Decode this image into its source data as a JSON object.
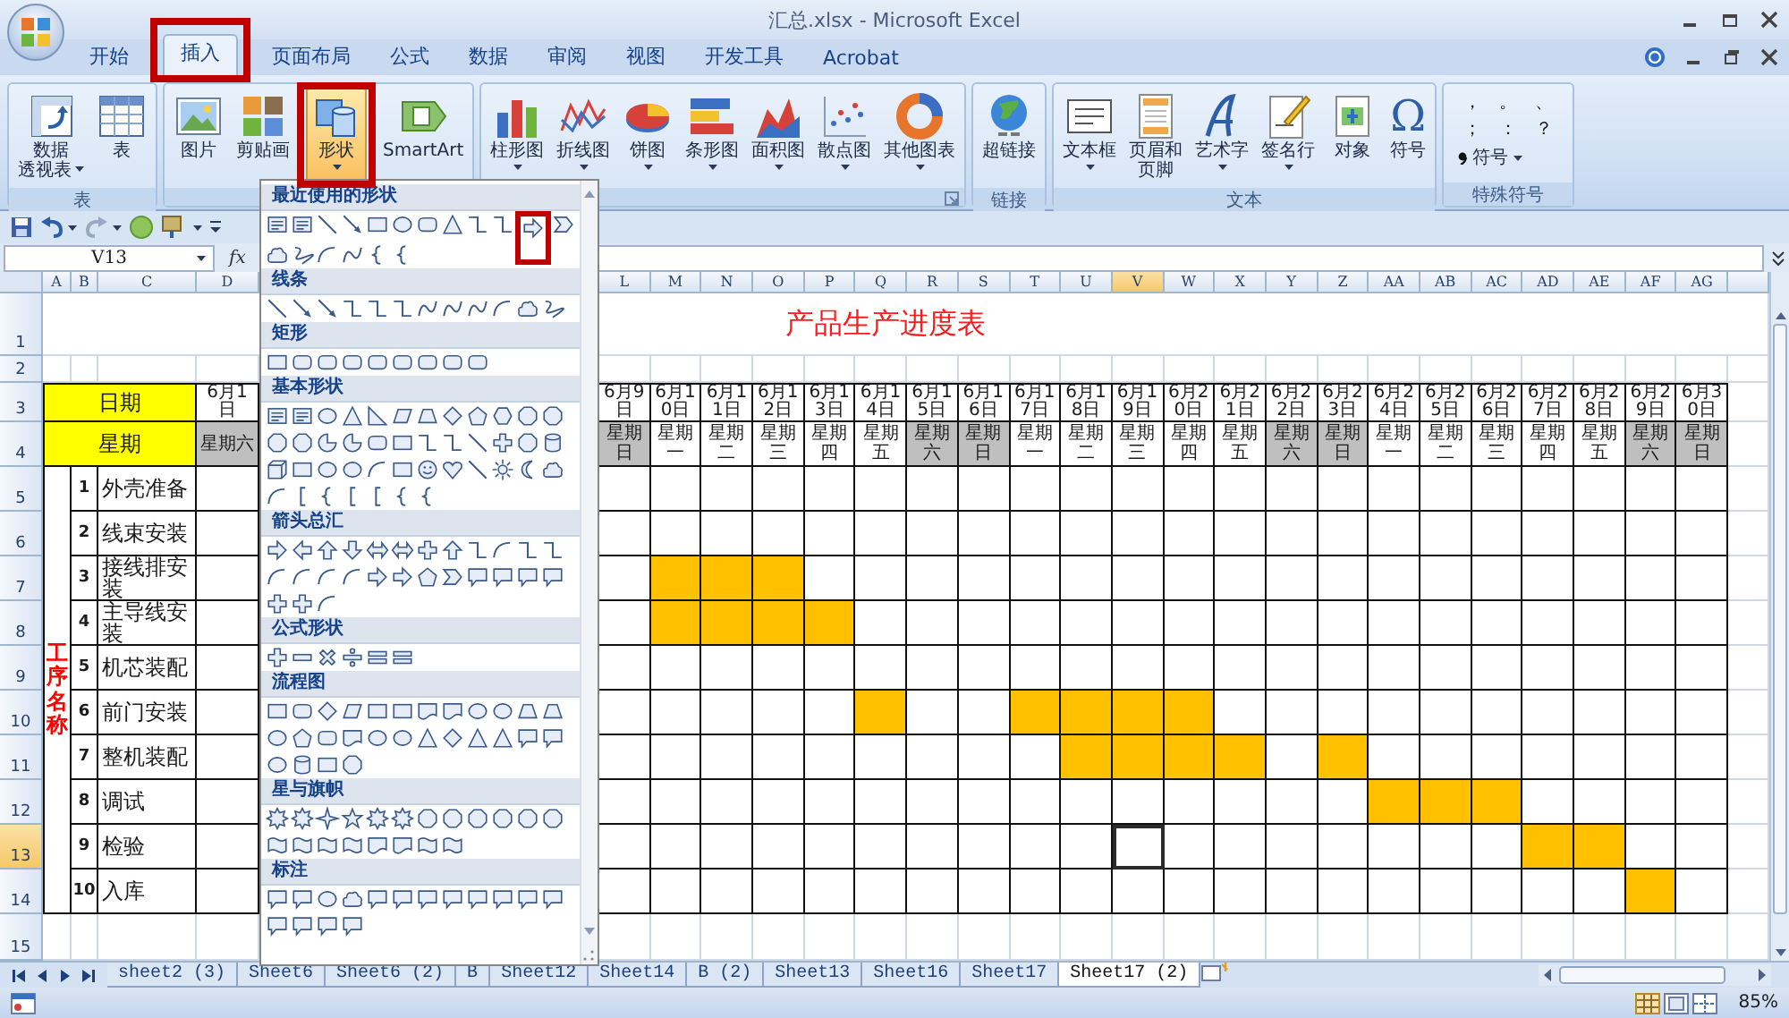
{
  "window": {
    "title": "汇总.xlsx - Microsoft Excel"
  },
  "ribbon_tabs": [
    {
      "label": "开始",
      "selected": false
    },
    {
      "label": "插入",
      "selected": true
    },
    {
      "label": "页面布局",
      "selected": false
    },
    {
      "label": "公式",
      "selected": false
    },
    {
      "label": "数据",
      "selected": false
    },
    {
      "label": "审阅",
      "selected": false
    },
    {
      "label": "视图",
      "selected": false
    },
    {
      "label": "开发工具",
      "selected": false
    },
    {
      "label": "Acrobat",
      "selected": false
    }
  ],
  "ribbon": {
    "groups": [
      {
        "kind": "buttons",
        "label": "表",
        "launcher": false,
        "buttons": [
          {
            "lines": [
              "数据",
              "透视表"
            ],
            "dropdown": true,
            "selected": false
          },
          {
            "label": "表",
            "dropdown": false,
            "selected": false
          }
        ]
      },
      {
        "kind": "buttons",
        "launcher": false,
        "buttons": [
          {
            "label": "图片",
            "dropdown": false,
            "selected": false
          },
          {
            "label": "剪贴画",
            "dropdown": false,
            "selected": false
          },
          {
            "label": "形状",
            "dropdown": true,
            "selected": true
          },
          {
            "label": "SmartArt",
            "dropdown": false,
            "selected": false
          }
        ]
      },
      {
        "kind": "buttons",
        "launcher": true,
        "buttons": [
          {
            "label": "柱形图",
            "dropdown": true,
            "selected": false
          },
          {
            "label": "折线图",
            "dropdown": true,
            "selected": false
          },
          {
            "label": "饼图",
            "dropdown": true,
            "selected": false
          },
          {
            "label": "条形图",
            "dropdown": true,
            "selected": false
          },
          {
            "label": "面积图",
            "dropdown": true,
            "selected": false
          },
          {
            "label": "散点图",
            "dropdown": true,
            "selected": false
          },
          {
            "label": "其他图表",
            "dropdown": true,
            "selected": false
          }
        ]
      },
      {
        "kind": "buttons",
        "label": "链接",
        "launcher": false,
        "buttons": [
          {
            "label": "超链接",
            "dropdown": false,
            "selected": false
          }
        ]
      },
      {
        "kind": "buttons",
        "label": "文本",
        "launcher": false,
        "buttons": [
          {
            "label": "文本框",
            "dropdown": true,
            "selected": false
          },
          {
            "lines": [
              "页眉和",
              "页脚"
            ],
            "dropdown": false,
            "selected": false
          },
          {
            "label": "艺术字",
            "dropdown": true,
            "selected": false
          },
          {
            "label": "签名行",
            "dropdown": true,
            "selected": false
          },
          {
            "label": "对象",
            "dropdown": false,
            "selected": false
          },
          {
            "label": "符号",
            "glyph": "Ω",
            "dropdown": false,
            "selected": false
          }
        ]
      },
      {
        "kind": "symbols",
        "label": "特殊符号",
        "launcher": false,
        "symbols": [
          "，",
          "。",
          "、",
          "；",
          "：",
          "？"
        ],
        "menu": {
          "label": "符号",
          "dropdown": true
        }
      }
    ]
  },
  "formula_bar": {
    "name_box": "V13",
    "function_label": "fx"
  },
  "shapes_menu": {
    "sections": [
      {
        "title": "最近使用的形状"
      },
      {
        "title": "线条"
      },
      {
        "title": "矩形"
      },
      {
        "title": "基本形状"
      },
      {
        "title": "箭头总汇"
      },
      {
        "title": "公式形状"
      },
      {
        "title": "流程图"
      },
      {
        "title": "星与旗帜"
      },
      {
        "title": "标注"
      }
    ]
  },
  "sheet": {
    "columns": [
      {
        "label": "A",
        "selected": false
      },
      {
        "label": "B",
        "selected": false
      },
      {
        "label": "C",
        "selected": false
      },
      {
        "label": "D",
        "selected": false
      },
      {
        "label": "L",
        "selected": false
      },
      {
        "label": "M",
        "selected": false
      },
      {
        "label": "N",
        "selected": false
      },
      {
        "label": "O",
        "selected": false
      },
      {
        "label": "P",
        "selected": false
      },
      {
        "label": "Q",
        "selected": false
      },
      {
        "label": "R",
        "selected": false
      },
      {
        "label": "S",
        "selected": false
      },
      {
        "label": "T",
        "selected": false
      },
      {
        "label": "U",
        "selected": false
      },
      {
        "label": "V",
        "selected": true
      },
      {
        "label": "W",
        "selected": false
      },
      {
        "label": "X",
        "selected": false
      },
      {
        "label": "Y",
        "selected": false
      },
      {
        "label": "Z",
        "selected": false
      },
      {
        "label": "AA",
        "selected": false
      },
      {
        "label": "AB",
        "selected": false
      },
      {
        "label": "AC",
        "selected": false
      },
      {
        "label": "AD",
        "selected": false
      },
      {
        "label": "AE",
        "selected": false
      },
      {
        "label": "AF",
        "selected": false
      },
      {
        "label": "AG",
        "selected": false
      }
    ],
    "rows": [
      {
        "label": "1",
        "selected": false
      },
      {
        "label": "2",
        "selected": false
      },
      {
        "label": "3",
        "selected": false
      },
      {
        "label": "4",
        "selected": false
      },
      {
        "label": "5",
        "selected": false
      },
      {
        "label": "6",
        "selected": false
      },
      {
        "label": "7",
        "selected": false
      },
      {
        "label": "8",
        "selected": false
      },
      {
        "label": "9",
        "selected": false
      },
      {
        "label": "10",
        "selected": false
      },
      {
        "label": "11",
        "selected": false
      },
      {
        "label": "12",
        "selected": false
      },
      {
        "label": "13",
        "selected": true
      },
      {
        "label": "14",
        "selected": false
      },
      {
        "label": "15",
        "selected": false
      }
    ],
    "title": "产品生产进度表",
    "date_label": "日期",
    "weekday_label": "星期",
    "process_label": "工序名称",
    "days": [
      {
        "date": "6月1日",
        "weekday": "星期六",
        "weekend": true
      },
      {
        "date": "6月9日",
        "weekday": "星期日",
        "weekend": true
      },
      {
        "date": "6月10日",
        "weekday": "星期一",
        "weekend": false
      },
      {
        "date": "6月11日",
        "weekday": "星期二",
        "weekend": false
      },
      {
        "date": "6月12日",
        "weekday": "星期三",
        "weekend": false
      },
      {
        "date": "6月13日",
        "weekday": "星期四",
        "weekend": false
      },
      {
        "date": "6月14日",
        "weekday": "星期五",
        "weekend": false
      },
      {
        "date": "6月15日",
        "weekday": "星期六",
        "weekend": true
      },
      {
        "date": "6月16日",
        "weekday": "星期日",
        "weekend": true
      },
      {
        "date": "6月17日",
        "weekday": "星期一",
        "weekend": false
      },
      {
        "date": "6月18日",
        "weekday": "星期二",
        "weekend": false
      },
      {
        "date": "6月19日",
        "weekday": "星期三",
        "weekend": false
      },
      {
        "date": "6月20日",
        "weekday": "星期四",
        "weekend": false
      },
      {
        "date": "6月21日",
        "weekday": "星期五",
        "weekend": false
      },
      {
        "date": "6月22日",
        "weekday": "星期六",
        "weekend": true
      },
      {
        "date": "6月23日",
        "weekday": "星期日",
        "weekend": true
      },
      {
        "date": "6月24日",
        "weekday": "星期一",
        "weekend": false
      },
      {
        "date": "6月25日",
        "weekday": "星期二",
        "weekend": false
      },
      {
        "date": "6月26日",
        "weekday": "星期三",
        "weekend": false
      },
      {
        "date": "6月27日",
        "weekday": "星期四",
        "weekend": false
      },
      {
        "date": "6月28日",
        "weekday": "星期五",
        "weekend": false
      },
      {
        "date": "6月29日",
        "weekday": "星期六",
        "weekend": true
      },
      {
        "date": "6月30日",
        "weekday": "星期日",
        "weekend": true
      }
    ],
    "tasks": [
      {
        "no": "1",
        "name": "外壳准备",
        "filled": [
          false,
          false,
          false,
          false,
          false,
          false,
          false,
          false,
          false,
          false,
          false,
          false,
          false,
          false,
          false,
          false,
          false,
          false,
          false,
          false,
          false,
          false,
          false
        ],
        "selected": [
          false,
          false,
          false,
          false,
          false,
          false,
          false,
          false,
          false,
          false,
          false,
          false,
          false,
          false,
          false,
          false,
          false,
          false,
          false,
          false,
          false,
          false,
          false
        ]
      },
      {
        "no": "2",
        "name": "线束安装",
        "filled": [
          false,
          false,
          false,
          false,
          false,
          false,
          false,
          false,
          false,
          false,
          false,
          false,
          false,
          false,
          false,
          false,
          false,
          false,
          false,
          false,
          false,
          false,
          false
        ],
        "selected": [
          false,
          false,
          false,
          false,
          false,
          false,
          false,
          false,
          false,
          false,
          false,
          false,
          false,
          false,
          false,
          false,
          false,
          false,
          false,
          false,
          false,
          false,
          false
        ]
      },
      {
        "no": "3",
        "name": "接线排安装",
        "filled": [
          false,
          false,
          true,
          true,
          true,
          false,
          false,
          false,
          false,
          false,
          false,
          false,
          false,
          false,
          false,
          false,
          false,
          false,
          false,
          false,
          false,
          false,
          false
        ],
        "selected": [
          false,
          false,
          false,
          false,
          false,
          false,
          false,
          false,
          false,
          false,
          false,
          false,
          false,
          false,
          false,
          false,
          false,
          false,
          false,
          false,
          false,
          false,
          false
        ]
      },
      {
        "no": "4",
        "name": "主导线安装",
        "filled": [
          false,
          false,
          true,
          true,
          true,
          true,
          false,
          false,
          false,
          false,
          false,
          false,
          false,
          false,
          false,
          false,
          false,
          false,
          false,
          false,
          false,
          false,
          false
        ],
        "selected": [
          false,
          false,
          false,
          false,
          false,
          false,
          false,
          false,
          false,
          false,
          false,
          false,
          false,
          false,
          false,
          false,
          false,
          false,
          false,
          false,
          false,
          false,
          false
        ]
      },
      {
        "no": "5",
        "name": "机芯装配",
        "filled": [
          false,
          false,
          false,
          false,
          false,
          false,
          false,
          false,
          false,
          false,
          false,
          false,
          false,
          false,
          false,
          false,
          false,
          false,
          false,
          false,
          false,
          false,
          false
        ],
        "selected": [
          false,
          false,
          false,
          false,
          false,
          false,
          false,
          false,
          false,
          false,
          false,
          false,
          false,
          false,
          false,
          false,
          false,
          false,
          false,
          false,
          false,
          false,
          false
        ]
      },
      {
        "no": "6",
        "name": "前门安装",
        "filled": [
          false,
          false,
          false,
          false,
          false,
          false,
          true,
          false,
          false,
          true,
          true,
          true,
          true,
          false,
          false,
          false,
          false,
          false,
          false,
          false,
          false,
          false,
          false
        ],
        "selected": [
          false,
          false,
          false,
          false,
          false,
          false,
          false,
          false,
          false,
          false,
          false,
          false,
          false,
          false,
          false,
          false,
          false,
          false,
          false,
          false,
          false,
          false,
          false
        ]
      },
      {
        "no": "7",
        "name": "整机装配",
        "filled": [
          false,
          false,
          false,
          false,
          false,
          false,
          false,
          false,
          false,
          false,
          true,
          true,
          true,
          true,
          false,
          true,
          false,
          false,
          false,
          false,
          false,
          false,
          false
        ],
        "selected": [
          false,
          false,
          false,
          false,
          false,
          false,
          false,
          false,
          false,
          false,
          false,
          false,
          false,
          false,
          false,
          false,
          false,
          false,
          false,
          false,
          false,
          false,
          false
        ]
      },
      {
        "no": "8",
        "name": "调试",
        "filled": [
          false,
          false,
          false,
          false,
          false,
          false,
          false,
          false,
          false,
          false,
          false,
          false,
          false,
          false,
          false,
          false,
          true,
          true,
          true,
          false,
          false,
          false,
          false
        ],
        "selected": [
          false,
          false,
          false,
          false,
          false,
          false,
          false,
          false,
          false,
          false,
          false,
          false,
          false,
          false,
          false,
          false,
          false,
          false,
          false,
          false,
          false,
          false,
          false
        ]
      },
      {
        "no": "9",
        "name": "检验",
        "filled": [
          false,
          false,
          false,
          false,
          false,
          false,
          false,
          false,
          false,
          false,
          false,
          false,
          false,
          false,
          false,
          false,
          false,
          false,
          false,
          true,
          true,
          false,
          false
        ],
        "selected": [
          false,
          false,
          false,
          false,
          false,
          false,
          false,
          false,
          false,
          false,
          false,
          true,
          false,
          false,
          false,
          false,
          false,
          false,
          false,
          false,
          false,
          false,
          false
        ]
      },
      {
        "no": "10",
        "name": "入库",
        "filled": [
          false,
          false,
          false,
          false,
          false,
          false,
          false,
          false,
          false,
          false,
          false,
          false,
          false,
          false,
          false,
          false,
          false,
          false,
          false,
          false,
          false,
          true,
          false
        ],
        "selected": [
          false,
          false,
          false,
          false,
          false,
          false,
          false,
          false,
          false,
          false,
          false,
          false,
          false,
          false,
          false,
          false,
          false,
          false,
          false,
          false,
          false,
          false,
          false
        ]
      }
    ]
  },
  "sheet_tabs": [
    {
      "label": "sheet2 (3)",
      "selected": false
    },
    {
      "label": "Sheet6",
      "selected": false
    },
    {
      "label": "Sheet6 (2)",
      "selected": false
    },
    {
      "label": "B",
      "selected": false
    },
    {
      "label": "Sheet12",
      "selected": false
    },
    {
      "label": "Sheet14",
      "selected": false
    },
    {
      "label": "B (2)",
      "selected": false
    },
    {
      "label": "Sheet13",
      "selected": false
    },
    {
      "label": "Sheet16",
      "selected": false
    },
    {
      "label": "Sheet17",
      "selected": false
    },
    {
      "label": "Sheet17 (2)",
      "selected": true
    }
  ],
  "status_bar": {
    "zoom": "85%"
  }
}
